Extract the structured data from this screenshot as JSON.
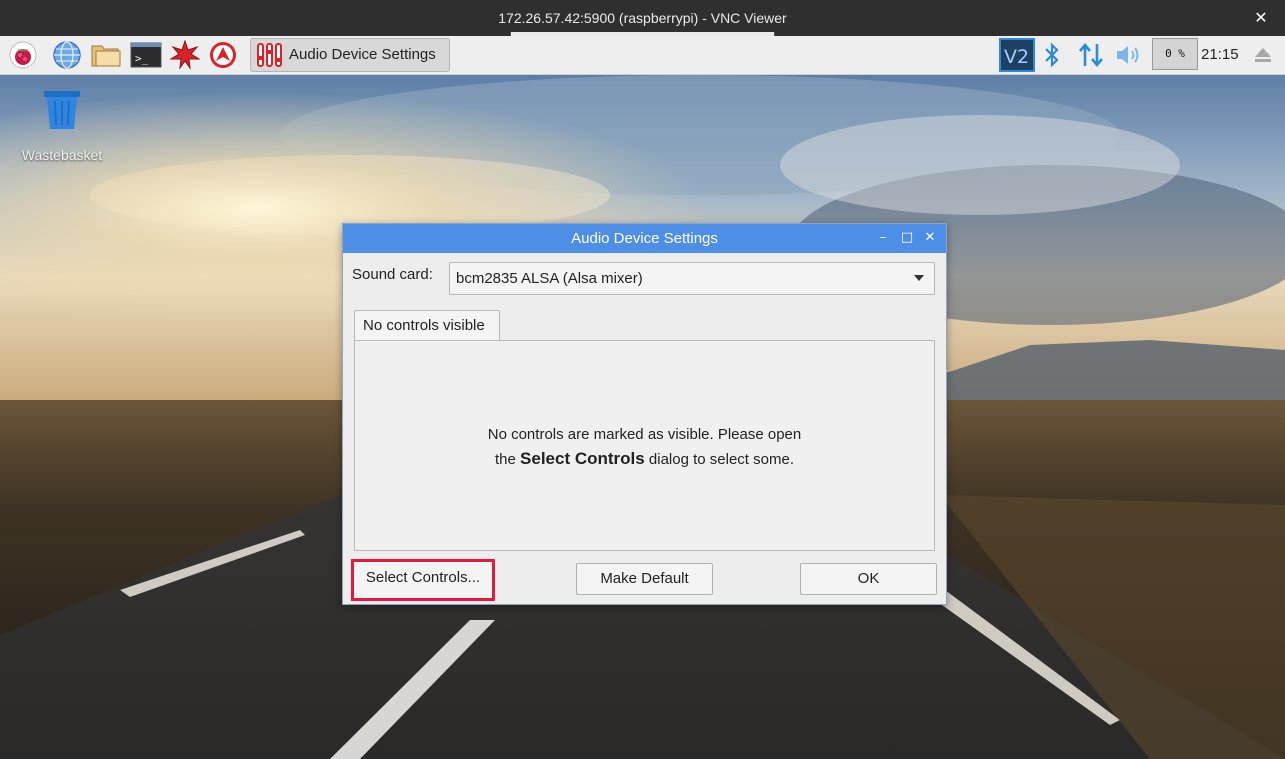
{
  "vnc": {
    "title": "172.26.57.42:5900 (raspberrypi) - VNC Viewer",
    "close_icon": "close-icon"
  },
  "taskbar": {
    "launchers": [
      "raspberry-menu-icon",
      "web-browser-icon",
      "file-manager-icon",
      "terminal-icon",
      "mathematica-icon",
      "wolfram-icon"
    ],
    "active_task_label": "Audio Device Settings",
    "tray_icons": [
      "vnc-server-icon",
      "bluetooth-icon",
      "network-icon",
      "volume-icon",
      "eject-icon"
    ],
    "cpu_usage": "0 %",
    "clock": "21:15"
  },
  "desktop": {
    "wastebasket_label": "Wastebasket"
  },
  "dialog": {
    "title": "Audio Device Settings",
    "sound_card_label": "Sound card:",
    "sound_card_value": "bcm2835 ALSA (Alsa mixer)",
    "tab_label": "No controls visible",
    "message_line1": "No controls are marked as visible. Please open",
    "message_prefix": "the ",
    "message_bold": "Select Controls",
    "message_suffix": " dialog to select some.",
    "select_controls_label": "Select Controls...",
    "make_default_label": "Make Default",
    "ok_label": "OK"
  },
  "colors": {
    "dialog_titlebar": "#4d8ee7",
    "highlight": "#e8173c",
    "tray_blue": "#2d8ad6"
  }
}
